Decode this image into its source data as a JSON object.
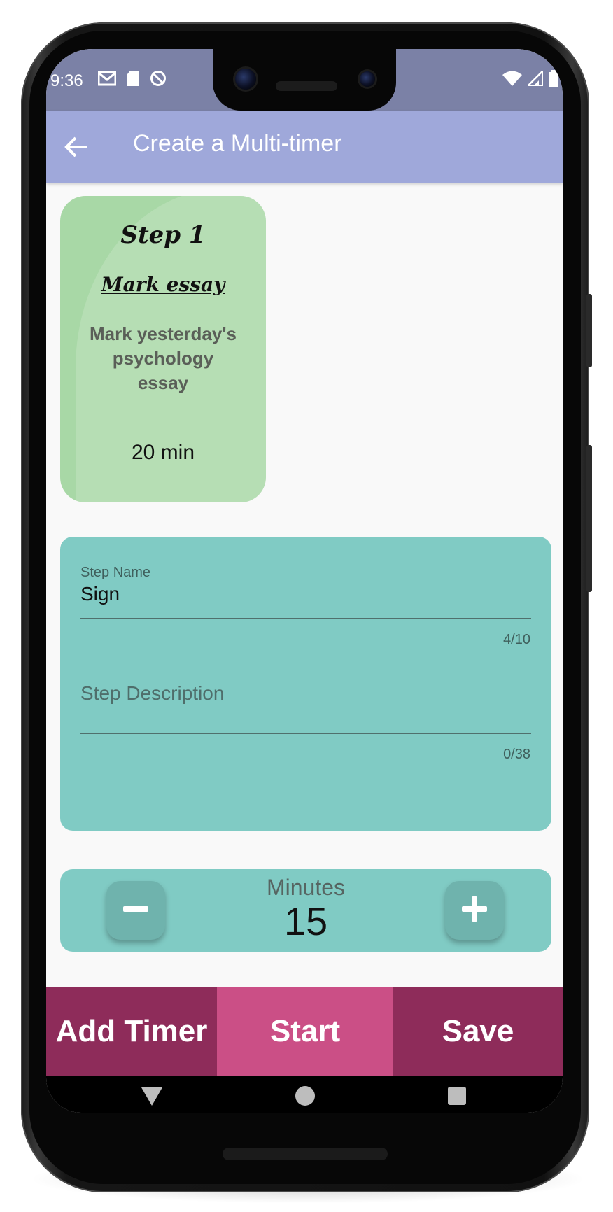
{
  "status_bar": {
    "time": "9:36",
    "left_icons": [
      "gmail-icon",
      "sd-card-icon",
      "do-not-disturb-icon"
    ],
    "right_icons": [
      "wifi-icon",
      "cell-signal-icon",
      "battery-icon"
    ]
  },
  "app_bar": {
    "title": "Create a Multi-timer",
    "back_icon": "arrow-back-icon",
    "color": "#9fa8da"
  },
  "step_card": {
    "step_label": "Step 1",
    "title": "Mark essay",
    "description": "Mark yesterday's psychology essay",
    "duration": "20 min",
    "color": "#a8d8a6"
  },
  "form": {
    "step_name": {
      "label": "Step Name",
      "value": "Sign",
      "counter": "4/10"
    },
    "step_description": {
      "placeholder": "Step Description",
      "counter": "0/38"
    },
    "color": "#80cbc4"
  },
  "minutes": {
    "label": "Minutes",
    "value": "15",
    "decrement_icon": "minus-icon",
    "increment_icon": "plus-icon"
  },
  "actions": {
    "add_timer": "Add Timer",
    "start": "Start",
    "save": "Save",
    "primary_color": "#8e2c5a",
    "accent_color": "#cb4f86"
  },
  "nav": {
    "back_icon": "nav-back-icon",
    "home_icon": "nav-home-icon",
    "recents_icon": "nav-recents-icon"
  }
}
